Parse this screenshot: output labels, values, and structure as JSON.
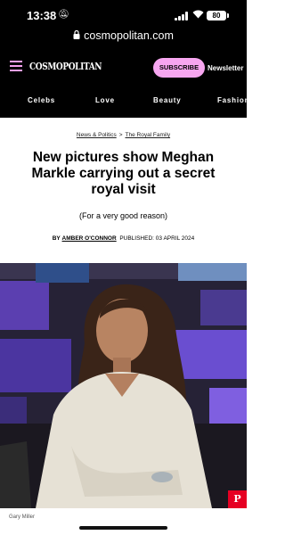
{
  "status_bar": {
    "time": "13:38",
    "battery": "80"
  },
  "browser": {
    "url": "cosmopolitan.com"
  },
  "header": {
    "logo": "COSMOPOLITAN",
    "subscribe_label": "SUBSCRIBE",
    "newsletter_label": "Newsletter"
  },
  "categories": [
    "Celebs",
    "Love",
    "Beauty",
    "Fashion"
  ],
  "article": {
    "breadcrumb": [
      "News & Politics",
      "The Royal Family"
    ],
    "breadcrumb_separator": ">",
    "headline": "New pictures show Meghan Markle carrying out a secret royal visit",
    "dek": "(For a very good reason)",
    "byline_prefix": "BY",
    "author": "AMBER O'CONNOR",
    "published_label": "PUBLISHED:",
    "published_date": "03 APRIL 2024",
    "photo_credit": "Gary Miller"
  },
  "colors": {
    "accent_pink": "#f7a6f0",
    "pinterest_red": "#e60023"
  },
  "icons": [
    "bell-mute-icon",
    "signal-icon",
    "wifi-icon",
    "battery-icon",
    "lock-icon",
    "hamburger-menu-icon",
    "pinterest-icon"
  ]
}
